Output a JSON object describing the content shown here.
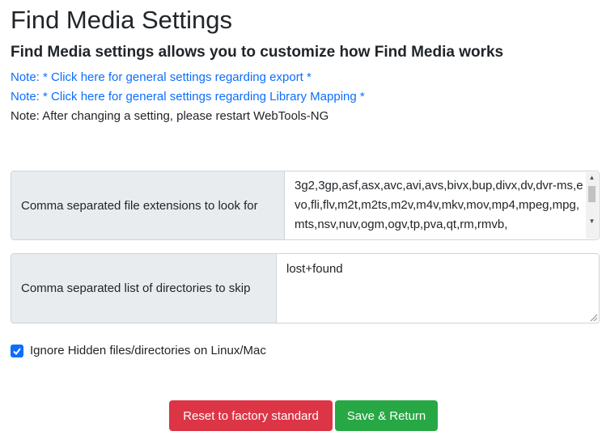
{
  "header": {
    "title": "Find Media Settings",
    "subtitle": "Find Media settings allows you to customize how Find Media works"
  },
  "notes": {
    "export_link": "Note: * Click here for general settings regarding export *",
    "mapping_link": "Note: * Click here for general settings regarding Library Mapping *",
    "restart_text": "Note: After changing a setting, please restart WebTools-NG"
  },
  "settings": {
    "extensions": {
      "label": "Comma separated file extensions to look for",
      "value": "3g2,3gp,asf,asx,avc,avi,avs,bivx,bup,divx,dv,dvr-ms,evo,fli,flv,m2t,m2ts,m2v,m4v,mkv,mov,mp4,mpeg,mpg,mts,nsv,nuv,ogm,ogv,tp,pva,qt,rm,rmvb,"
    },
    "directories": {
      "label": "Comma separated list of directories to skip",
      "value": "lost+found"
    },
    "ignore_hidden": {
      "label": "Ignore Hidden files/directories on Linux/Mac",
      "checked": true
    }
  },
  "buttons": {
    "reset_label": "Reset to factory standard",
    "save_label": "Save & Return"
  },
  "colors": {
    "link": "#0d6efd",
    "danger": "#dc3545",
    "success": "#28a745",
    "checkbox": "#0d6efd"
  }
}
